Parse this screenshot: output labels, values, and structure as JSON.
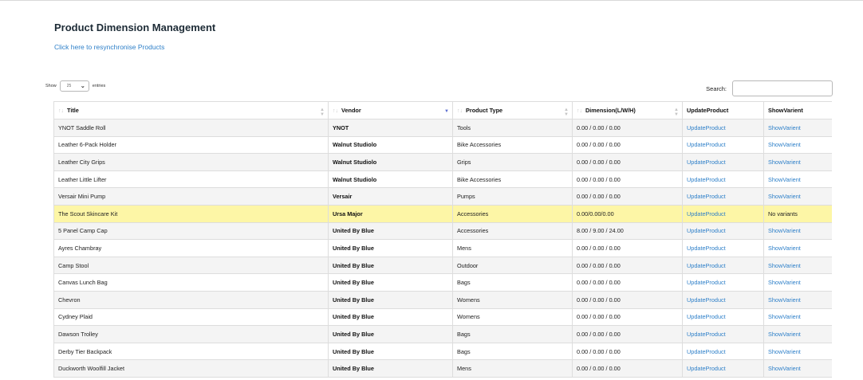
{
  "header": {
    "title": "Product Dimension Management",
    "resync_link": "Click here to resynchronise Products"
  },
  "length": {
    "prefix": "Show",
    "selected": "25",
    "suffix": "entries"
  },
  "search": {
    "label": "Search:",
    "value": ""
  },
  "table": {
    "columns": [
      "Title",
      "Vendor",
      "Product Type",
      "Dimension(L/W/H)",
      "UpdateProduct",
      "ShowVarient"
    ],
    "sort_column": "Vendor",
    "rows": [
      {
        "title": "YNOT Saddle Roll",
        "vendor": "YNOT",
        "type": "Tools",
        "dimension": "0.00 / 0.00 / 0.00",
        "update": "UpdateProduct",
        "show": "ShowVarient",
        "show_is_link": true,
        "highlight": false
      },
      {
        "title": "Leather 6-Pack Holder",
        "vendor": "Walnut Studiolo",
        "type": "Bike Accessories",
        "dimension": "0.00 / 0.00 / 0.00",
        "update": "UpdateProduct",
        "show": "ShowVarient",
        "show_is_link": true,
        "highlight": false
      },
      {
        "title": "Leather City Grips",
        "vendor": "Walnut Studiolo",
        "type": "Grips",
        "dimension": "0.00 / 0.00 / 0.00",
        "update": "UpdateProduct",
        "show": "ShowVarient",
        "show_is_link": true,
        "highlight": false
      },
      {
        "title": "Leather Little Lifter",
        "vendor": "Walnut Studiolo",
        "type": "Bike Accessories",
        "dimension": "0.00 / 0.00 / 0.00",
        "update": "UpdateProduct",
        "show": "ShowVarient",
        "show_is_link": true,
        "highlight": false
      },
      {
        "title": "Versair Mini Pump",
        "vendor": "Versair",
        "type": "Pumps",
        "dimension": "0.00 / 0.00 / 0.00",
        "update": "UpdateProduct",
        "show": "ShowVarient",
        "show_is_link": true,
        "highlight": false
      },
      {
        "title": "The Scout Skincare Kit",
        "vendor": "Ursa Major",
        "type": "Accessories",
        "dimension": "0.00/0.00/0.00",
        "update": "UpdateProduct",
        "show": "No variants",
        "show_is_link": false,
        "highlight": true
      },
      {
        "title": "5 Panel Camp Cap",
        "vendor": "United By Blue",
        "type": "Accessories",
        "dimension": "8.00 / 9.00 / 24.00",
        "update": "UpdateProduct",
        "show": "ShowVarient",
        "show_is_link": true,
        "highlight": false
      },
      {
        "title": "Ayres Chambray",
        "vendor": "United By Blue",
        "type": "Mens",
        "dimension": "0.00 / 0.00 / 0.00",
        "update": "UpdateProduct",
        "show": "ShowVarient",
        "show_is_link": true,
        "highlight": false
      },
      {
        "title": "Camp Stool",
        "vendor": "United By Blue",
        "type": "Outdoor",
        "dimension": "0.00 / 0.00 / 0.00",
        "update": "UpdateProduct",
        "show": "ShowVarient",
        "show_is_link": true,
        "highlight": false
      },
      {
        "title": "Canvas Lunch Bag",
        "vendor": "United By Blue",
        "type": "Bags",
        "dimension": "0.00 / 0.00 / 0.00",
        "update": "UpdateProduct",
        "show": "ShowVarient",
        "show_is_link": true,
        "highlight": false
      },
      {
        "title": "Chevron",
        "vendor": "United By Blue",
        "type": "Womens",
        "dimension": "0.00 / 0.00 / 0.00",
        "update": "UpdateProduct",
        "show": "ShowVarient",
        "show_is_link": true,
        "highlight": false
      },
      {
        "title": "Cydney Plaid",
        "vendor": "United By Blue",
        "type": "Womens",
        "dimension": "0.00 / 0.00 / 0.00",
        "update": "UpdateProduct",
        "show": "ShowVarient",
        "show_is_link": true,
        "highlight": false
      },
      {
        "title": "Dawson Trolley",
        "vendor": "United By Blue",
        "type": "Bags",
        "dimension": "0.00 / 0.00 / 0.00",
        "update": "UpdateProduct",
        "show": "ShowVarient",
        "show_is_link": true,
        "highlight": false
      },
      {
        "title": "Derby Tier Backpack",
        "vendor": "United By Blue",
        "type": "Bags",
        "dimension": "0.00 / 0.00 / 0.00",
        "update": "UpdateProduct",
        "show": "ShowVarient",
        "show_is_link": true,
        "highlight": false
      },
      {
        "title": "Duckworth Woolfill Jacket",
        "vendor": "United By Blue",
        "type": "Mens",
        "dimension": "0.00 / 0.00 / 0.00",
        "update": "UpdateProduct",
        "show": "ShowVarient",
        "show_is_link": true,
        "highlight": false
      }
    ]
  },
  "colors": {
    "link": "#2f80c9",
    "highlight_row": "#fdf6a6",
    "striped_row": "#f4f4f4",
    "title_text": "#1d2b36"
  }
}
